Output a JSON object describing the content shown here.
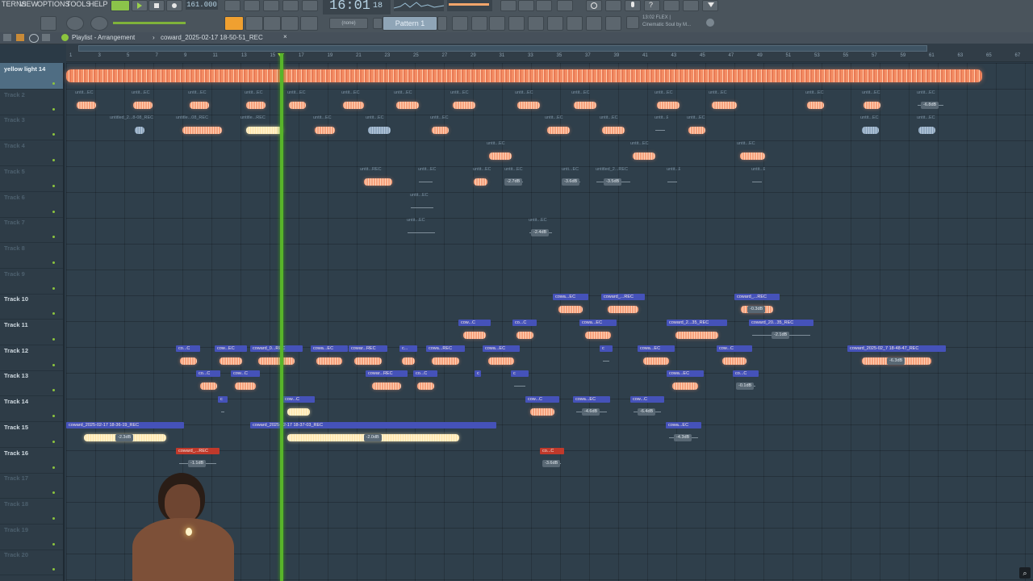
{
  "menu": [
    "TERNS",
    "VIEW",
    "OPTIONS",
    "TOOLS",
    "HELP"
  ],
  "transport": {
    "tempo": "161.000",
    "time": "16:01",
    "time_small": "18"
  },
  "pattern": {
    "label": "Pattern 1",
    "snap": "(none)"
  },
  "plugin_hint": {
    "line1": "13:02  FLEX |",
    "line2": "Cinematic Soul by M..."
  },
  "subbar": {
    "title": "Playlist - Arrangement",
    "sep": "›",
    "file": "coward_2025-02-17 18-50-51_REC",
    "close": "×"
  },
  "ruler_marks": [
    "1",
    "3",
    "5",
    "7",
    "9",
    "11",
    "13",
    "15",
    "17",
    "19",
    "21",
    "23",
    "25",
    "27",
    "29",
    "31",
    "33",
    "35",
    "37",
    "39",
    "41",
    "43",
    "45",
    "47",
    "49",
    "51",
    "53",
    "55",
    "57",
    "59",
    "61",
    "63",
    "65",
    "67"
  ],
  "tracks": [
    {
      "name": "yellow light 14",
      "active": true
    },
    {
      "name": "Track 2",
      "active": false
    },
    {
      "name": "Track 3",
      "active": false
    },
    {
      "name": "Track 4",
      "active": false
    },
    {
      "name": "Track 5",
      "active": false
    },
    {
      "name": "Track 6",
      "active": false
    },
    {
      "name": "Track 7",
      "active": false
    },
    {
      "name": "Track 8",
      "active": false
    },
    {
      "name": "Track 9",
      "active": false
    },
    {
      "name": "Track 10",
      "active": true
    },
    {
      "name": "Track 11",
      "active": true
    },
    {
      "name": "Track 12",
      "active": true
    },
    {
      "name": "Track 13",
      "active": true
    },
    {
      "name": "Track 14",
      "active": true
    },
    {
      "name": "Track 15",
      "active": true
    },
    {
      "name": "Track 16",
      "active": true
    },
    {
      "name": "Track 17",
      "active": false
    },
    {
      "name": "Track 18",
      "active": false
    },
    {
      "name": "Track 19",
      "active": false
    },
    {
      "name": "Track 20",
      "active": false
    }
  ],
  "clips": [
    {
      "row": 1,
      "label": "untit...EC",
      "cap": "plain",
      "s": 90,
      "w": 34,
      "wave": "peach"
    },
    {
      "row": 1,
      "label": "untit...EC",
      "cap": "plain",
      "s": 160,
      "w": 34,
      "wave": "peach"
    },
    {
      "row": 1,
      "label": "untit...EC",
      "cap": "plain",
      "s": 230,
      "w": 34,
      "wave": "peach"
    },
    {
      "row": 1,
      "label": "untit...EC",
      "cap": "plain",
      "s": 300,
      "w": 34,
      "wave": "peach"
    },
    {
      "row": 1,
      "label": "untit...EC",
      "cap": "plain",
      "s": 353,
      "w": 30,
      "wave": "peach"
    },
    {
      "row": 1,
      "label": "untit...EC",
      "cap": "plain",
      "s": 420,
      "w": 36,
      "wave": "peach"
    },
    {
      "row": 1,
      "label": "untit...EC",
      "cap": "plain",
      "s": 485,
      "w": 40,
      "wave": "peach"
    },
    {
      "row": 1,
      "label": "untit...EC",
      "cap": "plain",
      "s": 555,
      "w": 40,
      "wave": "peach"
    },
    {
      "row": 1,
      "label": "untit...EC",
      "cap": "plain",
      "s": 635,
      "w": 40,
      "wave": "peach"
    },
    {
      "row": 1,
      "label": "untit...EC",
      "cap": "plain",
      "s": 705,
      "w": 40,
      "wave": "peach"
    },
    {
      "row": 1,
      "label": "untit...EC",
      "cap": "plain",
      "s": 808,
      "w": 40,
      "wave": "peach"
    },
    {
      "row": 1,
      "label": "untit...EC",
      "cap": "plain",
      "s": 875,
      "w": 45,
      "wave": "peach"
    },
    {
      "row": 1,
      "label": "untit...EC",
      "cap": "plain",
      "s": 995,
      "w": 30,
      "wave": "peach"
    },
    {
      "row": 1,
      "label": "untit...EC",
      "cap": "plain",
      "s": 1065,
      "w": 30,
      "wave": "peach"
    },
    {
      "row": 1,
      "label": "untit...EC",
      "cap": "plain",
      "s": 1133,
      "w": 40,
      "wave": "none",
      "tag": "-6.8dB"
    },
    {
      "row": 2,
      "label": "untitled_2...8-08_REC",
      "cap": "plain",
      "s": 133,
      "w": 80,
      "wave": "blue-dot"
    },
    {
      "row": 2,
      "label": "untitle...08_REC",
      "cap": "plain",
      "s": 215,
      "w": 70,
      "wave": "peach"
    },
    {
      "row": 2,
      "label": "untitle...REC",
      "cap": "plain",
      "s": 295,
      "w": 65,
      "wave": "cream"
    },
    {
      "row": 2,
      "label": "untit...EC",
      "cap": "plain",
      "s": 385,
      "w": 35,
      "wave": "peach"
    },
    {
      "row": 2,
      "label": "untit...EC",
      "cap": "plain",
      "s": 450,
      "w": 40,
      "wave": "blue"
    },
    {
      "row": 2,
      "label": "untit...EC",
      "cap": "plain",
      "s": 530,
      "w": 30,
      "wave": "peach"
    },
    {
      "row": 2,
      "label": "untit...EC",
      "cap": "plain",
      "s": 672,
      "w": 40,
      "wave": "peach"
    },
    {
      "row": 2,
      "label": "untit...EC",
      "cap": "plain",
      "s": 740,
      "w": 40,
      "wave": "peach"
    },
    {
      "row": 2,
      "label": "untit...EC",
      "cap": "plain",
      "s": 808,
      "w": 20,
      "wave": "none"
    },
    {
      "row": 2,
      "label": "untit...EC",
      "cap": "plain",
      "s": 848,
      "w": 30,
      "wave": "peach"
    },
    {
      "row": 2,
      "label": "untit...EC",
      "cap": "plain",
      "s": 1063,
      "w": 30,
      "wave": "blue"
    },
    {
      "row": 2,
      "label": "untit...EC",
      "cap": "plain",
      "s": 1133,
      "w": 30,
      "wave": "blue"
    },
    {
      "row": 3,
      "label": "untit...EC",
      "cap": "plain",
      "s": 600,
      "w": 40,
      "wave": "peach"
    },
    {
      "row": 3,
      "label": "untit...EC",
      "cap": "plain",
      "s": 778,
      "w": 40,
      "wave": "peach"
    },
    {
      "row": 3,
      "label": "untit...EC",
      "cap": "plain",
      "s": 910,
      "w": 45,
      "wave": "peach"
    },
    {
      "row": 4,
      "label": "untit...REC",
      "cap": "plain",
      "s": 443,
      "w": 50,
      "wave": "peach"
    },
    {
      "row": 4,
      "label": "untit...EC",
      "cap": "plain",
      "s": 515,
      "w": 25,
      "wave": "none"
    },
    {
      "row": 4,
      "label": "untit...EC",
      "cap": "plain",
      "s": 583,
      "w": 25,
      "wave": "peach"
    },
    {
      "row": 4,
      "label": "untit...EC",
      "cap": "plain",
      "s": 622,
      "w": 30,
      "wave": "none",
      "tag": "-2.7dB"
    },
    {
      "row": 4,
      "label": "unti...EC",
      "cap": "plain",
      "s": 693,
      "w": 30,
      "wave": "none",
      "tag": "-3.6dB"
    },
    {
      "row": 4,
      "label": "untitled_2...REC",
      "cap": "plain",
      "s": 735,
      "w": 50,
      "wave": "none",
      "tag": "-3.5dB"
    },
    {
      "row": 4,
      "label": "untit...EC",
      "cap": "plain",
      "s": 823,
      "w": 20,
      "wave": "none"
    },
    {
      "row": 4,
      "label": "untit...EC",
      "cap": "plain",
      "s": 928,
      "w": 20,
      "wave": "none"
    },
    {
      "row": 5,
      "label": "untit...EC",
      "cap": "plain",
      "s": 505,
      "w": 36,
      "wave": "none"
    },
    {
      "row": 6,
      "label": "untit...EC",
      "cap": "plain",
      "s": 501,
      "w": 42,
      "wave": "none"
    },
    {
      "row": 6,
      "label": "untit...EC",
      "cap": "plain",
      "s": 652,
      "w": 36,
      "wave": "none",
      "tag": "-2.4dB"
    },
    {
      "row": 9,
      "label": "cowa...EC",
      "cap": "blue",
      "s": 685,
      "w": 44,
      "wave": "peach"
    },
    {
      "row": 9,
      "label": "coward_...REC",
      "cap": "blue",
      "s": 745,
      "w": 54,
      "wave": "peach"
    },
    {
      "row": 9,
      "label": "coward_...REC",
      "cap": "blue",
      "s": 910,
      "w": 56,
      "wave": "peach",
      "tag": "-0.3dB"
    },
    {
      "row": 10,
      "label": "cow...C",
      "cap": "blue",
      "s": 568,
      "w": 40,
      "wave": "peach"
    },
    {
      "row": 10,
      "label": "co...C",
      "cap": "blue",
      "s": 635,
      "w": 30,
      "wave": "peach"
    },
    {
      "row": 10,
      "label": "cowa...EC",
      "cap": "blue",
      "s": 718,
      "w": 46,
      "wave": "peach"
    },
    {
      "row": 10,
      "label": "coward_2...35_REC",
      "cap": "blue",
      "s": 826,
      "w": 75,
      "wave": "peach"
    },
    {
      "row": 10,
      "label": "coward_20...35_REC",
      "cap": "blue",
      "s": 928,
      "w": 80,
      "wave": "none",
      "tag": "-2.1dB"
    },
    {
      "row": 11,
      "label": "co...C",
      "cap": "blue",
      "s": 218,
      "w": 30,
      "wave": "peach"
    },
    {
      "row": 11,
      "label": "cow...EC",
      "cap": "blue",
      "s": 266,
      "w": 40,
      "wave": "peach"
    },
    {
      "row": 11,
      "label": "coward_0...REC",
      "cap": "blue",
      "s": 310,
      "w": 65,
      "wave": "peach"
    },
    {
      "row": 11,
      "label": "cowa...EC",
      "cap": "blue",
      "s": 385,
      "w": 46,
      "wave": "peach"
    },
    {
      "row": 11,
      "label": "cowar...REC",
      "cap": "blue",
      "s": 432,
      "w": 48,
      "wave": "peach"
    },
    {
      "row": 11,
      "label": "c...",
      "cap": "blue",
      "s": 495,
      "w": 22,
      "wave": "peach"
    },
    {
      "row": 11,
      "label": "cowa...REC",
      "cap": "blue",
      "s": 528,
      "w": 48,
      "wave": "peach"
    },
    {
      "row": 11,
      "label": "cowa...EC",
      "cap": "blue",
      "s": 598,
      "w": 46,
      "wave": "peach"
    },
    {
      "row": 11,
      "label": "c",
      "cap": "blue",
      "s": 743,
      "w": 16,
      "wave": "none"
    },
    {
      "row": 11,
      "label": "cowa...EC",
      "cap": "blue",
      "s": 790,
      "w": 46,
      "wave": "peach"
    },
    {
      "row": 11,
      "label": "cow...C",
      "cap": "blue",
      "s": 888,
      "w": 44,
      "wave": "peach"
    },
    {
      "row": 11,
      "label": "coward_2025-02_7 18-48-47_REC",
      "cap": "blue",
      "s": 1050,
      "w": 122,
      "wave": "peach",
      "tag": "-6.3dB"
    },
    {
      "row": 12,
      "label": "co...C",
      "cap": "blue",
      "s": 243,
      "w": 30,
      "wave": "peach"
    },
    {
      "row": 12,
      "label": "cow...C",
      "cap": "blue",
      "s": 286,
      "w": 36,
      "wave": "peach"
    },
    {
      "row": 12,
      "label": "cowar...REC",
      "cap": "blue",
      "s": 453,
      "w": 52,
      "wave": "peach"
    },
    {
      "row": 12,
      "label": "co...C",
      "cap": "blue",
      "s": 512,
      "w": 30,
      "wave": "peach"
    },
    {
      "row": 12,
      "label": "c",
      "cap": "blue",
      "s": 588,
      "w": 8,
      "wave": "none"
    },
    {
      "row": 12,
      "label": "c",
      "cap": "blue",
      "s": 633,
      "w": 22,
      "wave": "none"
    },
    {
      "row": 12,
      "label": "cowa...EC",
      "cap": "blue",
      "s": 826,
      "w": 46,
      "wave": "peach"
    },
    {
      "row": 12,
      "label": "co...C",
      "cap": "blue",
      "s": 908,
      "w": 32,
      "wave": "none",
      "tag": "-0.1dB"
    },
    {
      "row": 13,
      "label": "c",
      "cap": "blue",
      "s": 270,
      "w": 12,
      "wave": "none"
    },
    {
      "row": 13,
      "label": "cow...C",
      "cap": "blue",
      "s": 350,
      "w": 40,
      "wave": "cream"
    },
    {
      "row": 13,
      "label": "cow...C",
      "cap": "blue",
      "s": 651,
      "w": 42,
      "wave": "peach"
    },
    {
      "row": 13,
      "label": "cowa...EC",
      "cap": "blue",
      "s": 710,
      "w": 46,
      "wave": "none",
      "tag": "-4.6dB"
    },
    {
      "row": 13,
      "label": "cow...C",
      "cap": "blue",
      "s": 781,
      "w": 42,
      "wave": "none",
      "tag": "-6.4dB"
    },
    {
      "row": 14,
      "label": "coward_2025-02-17 18-36-19_REC",
      "cap": "blue",
      "s": 82,
      "w": 146,
      "wave": "cream",
      "tag": "-2.3dB"
    },
    {
      "row": 14,
      "label": "coward_2025-02-17 18-37-03_REC",
      "cap": "blue",
      "s": 310,
      "w": 305,
      "wave": "cream",
      "tag": "-2.0dB"
    },
    {
      "row": 14,
      "label": "cowa...EC",
      "cap": "blue",
      "s": 825,
      "w": 44,
      "wave": "none",
      "tag": "-4.3dB"
    },
    {
      "row": 15,
      "label": "coward_...REC",
      "cap": "red",
      "s": 218,
      "w": 54,
      "wave": "none",
      "tag": "-1.1dB"
    },
    {
      "row": 15,
      "label": "co...C",
      "cap": "red",
      "s": 669,
      "w": 30,
      "wave": "none",
      "tag": "-3.6dB"
    }
  ]
}
